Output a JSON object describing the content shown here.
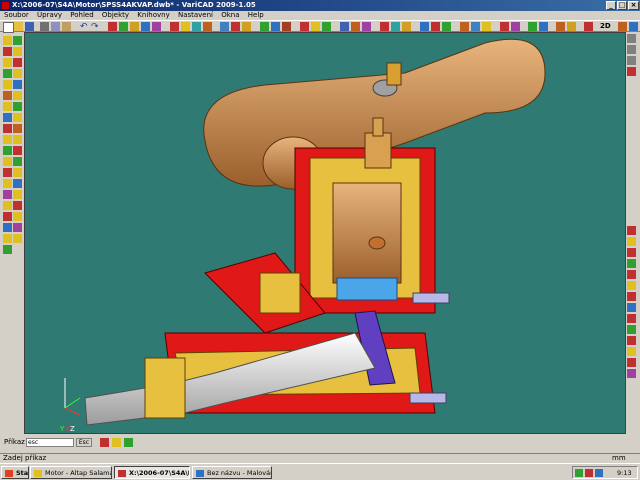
{
  "window": {
    "title": "X:\\2006-07\\S4A\\Motor\\SPSS4AKVAP.dwb* - VariCAD 2009-1.05"
  },
  "menu": [
    "Soubor",
    "Úpravy",
    "Pohled",
    "Objekty",
    "Knihovny",
    "Nastavení",
    "Okna",
    "Help"
  ],
  "toolbar": {
    "view_2d": "2D"
  },
  "axes": {
    "x": "X",
    "y": "Y",
    "z": "Z"
  },
  "command": {
    "prompt_label": "Příkaz",
    "value": "esc",
    "esc_label": "Esc"
  },
  "status": {
    "text": "Zadej příkaz",
    "units": "mm"
  },
  "taskbar": {
    "start": "Start",
    "tasks": [
      {
        "label": "Motor - Altap Salamande...",
        "active": false
      },
      {
        "label": "X:\\2006-07\\S4A\\Mot...",
        "active": true
      },
      {
        "label": "Bez názvu - Malování",
        "active": false
      }
    ],
    "clock": "9:13"
  },
  "colors": {
    "viewport_bg": "#2f7a72",
    "titlebar": "#0a246a",
    "copper": "#c68a4c",
    "section_red": "#e01818"
  }
}
